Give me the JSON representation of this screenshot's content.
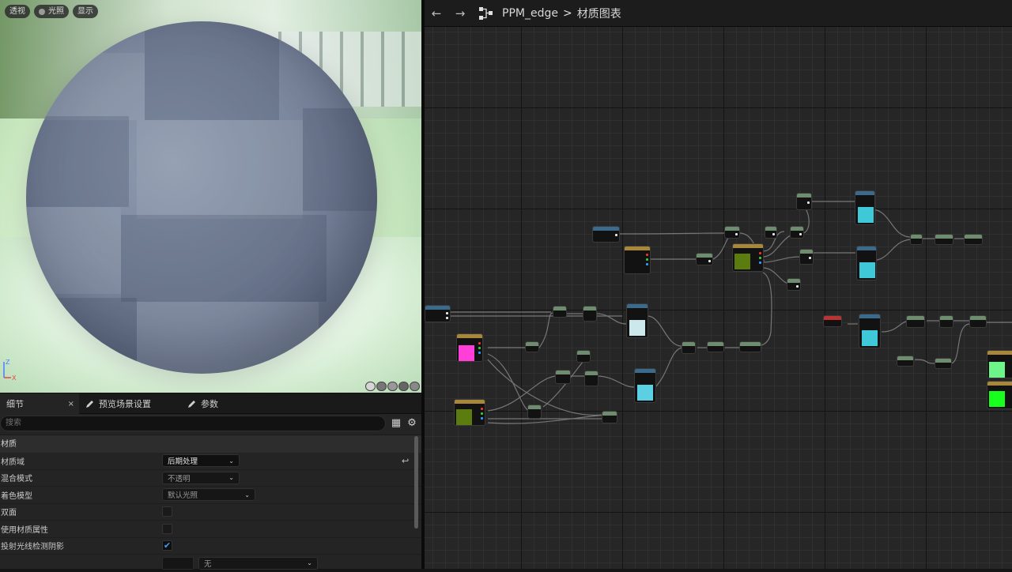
{
  "viewport": {
    "buttons": [
      {
        "label": "透视",
        "icon": null
      },
      {
        "label": "光照",
        "icon": "light-dot-icon"
      },
      {
        "label": "显示",
        "icon": null
      }
    ],
    "axis": {
      "z": "Z",
      "x": "X"
    }
  },
  "details": {
    "tabs": [
      {
        "label": "细节",
        "close": "×"
      },
      {
        "label": "预览场景设置"
      },
      {
        "label": "参数"
      }
    ],
    "search": {
      "placeholder": "搜索"
    },
    "section": "材质",
    "props": [
      {
        "label": "材质域",
        "value": "后期处理",
        "type": "dropdown-bright"
      },
      {
        "label": "混合模式",
        "value": "不透明",
        "type": "dropdown"
      },
      {
        "label": "着色模型",
        "value": "默认光照",
        "type": "dropdown"
      },
      {
        "label": "双面",
        "type": "checkbox",
        "checked": false
      },
      {
        "label": "使用材质属性",
        "type": "checkbox",
        "checked": false
      },
      {
        "label": "投射光线检测阴影",
        "type": "checkbox",
        "checked": true
      },
      {
        "label": "",
        "value": "无",
        "type": "dropdown-wide"
      }
    ]
  },
  "graph": {
    "breadcrumb": [
      "PPM_edge",
      "材质图表"
    ],
    "nav": {
      "back": "←",
      "forward": "→"
    },
    "separator": ">"
  },
  "colors": {
    "accent": "#3d9bff",
    "node_magenta": "#ff3fd8",
    "node_olive": "#5b7d10",
    "node_cyan": "#3ec8d8",
    "node_green": "#6ef58a",
    "node_bright_green": "#18ff1e"
  }
}
